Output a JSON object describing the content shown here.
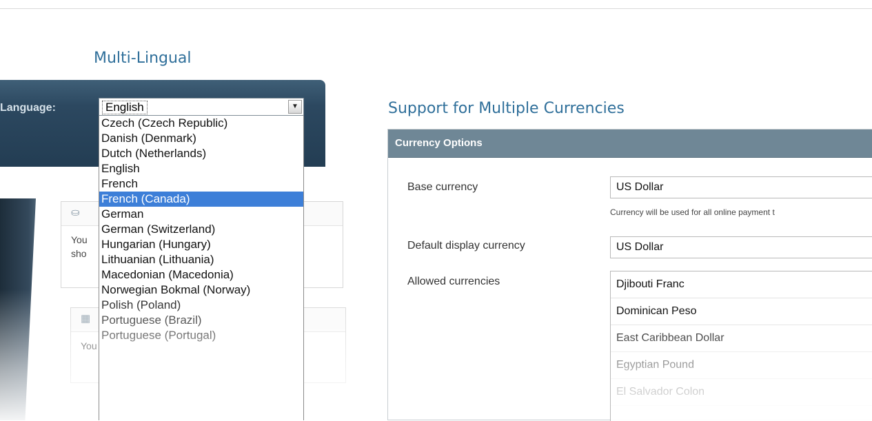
{
  "left": {
    "title": "Multi-Lingual",
    "language_label": "Language:",
    "selected_language": "English",
    "options": [
      "Czech (Czech Republic)",
      "Danish (Denmark)",
      "Dutch (Netherlands)",
      "English",
      "French",
      "French (Canada)",
      "German",
      "German (Switzerland)",
      "Hungarian (Hungary)",
      "Lithuanian (Lithuania)",
      "Macedonian (Macedonia)",
      "Norwegian Bokmal (Norway)",
      "Polish (Poland)",
      "Portuguese (Brazil)",
      "Portuguese (Portugal)"
    ],
    "highlighted_option": "French (Canada)",
    "widgets": [
      {
        "icon": "basket-icon",
        "text_line1": "You",
        "text_line2": "sho"
      },
      {
        "icon": "calendar-icon",
        "text_line1": "You"
      }
    ]
  },
  "right": {
    "title": "Support for Multiple Currencies",
    "panel_title": "Currency Options",
    "base_currency": {
      "label": "Base currency",
      "value": "US Dollar",
      "hint": "Currency will be used for all online payment t"
    },
    "default_display": {
      "label": "Default display currency",
      "value": "US Dollar"
    },
    "allowed": {
      "label": "Allowed currencies",
      "items": [
        "Djibouti Franc",
        "Dominican Peso",
        "East Caribbean Dollar",
        "Egyptian Pound",
        "El Salvador Colon"
      ]
    }
  },
  "colors": {
    "title_blue": "#2f6f9a",
    "nav_dark": "#233d53",
    "selection_blue": "#3d7fd8",
    "panel_header": "#6f8796"
  }
}
